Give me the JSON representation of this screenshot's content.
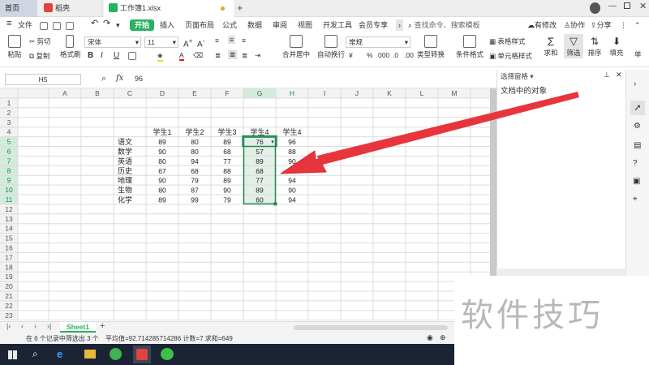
{
  "tabs": [
    {
      "label": "首页"
    },
    {
      "label": "稻壳"
    },
    {
      "label": "工作簿1.xlsx"
    }
  ],
  "menu": {
    "file": "文件",
    "items": [
      "开始",
      "插入",
      "页面布局",
      "公式",
      "数据",
      "审阅",
      "视图",
      "开发工具",
      "会员专享"
    ],
    "search_placeholder": "查找命令、搜索模板",
    "right": [
      "有修改",
      "协作",
      "分享"
    ]
  },
  "ribbon": {
    "paste": "粘贴",
    "cut": "剪切",
    "copy": "复制",
    "format_painter": "格式刷",
    "font": "宋体",
    "font_size": "11",
    "bold": "B",
    "italic": "I",
    "underline": "U",
    "merge": "合并居中",
    "wrap": "自动换行",
    "number_format": "常规",
    "percent": "%",
    "thousand": "000",
    "type_convert": "类型转换",
    "cond_format": "条件格式",
    "table_style": "表格样式",
    "cell_style": "单元格样式",
    "sum": "求和",
    "filter": "筛选",
    "sort": "排序",
    "fill": "填充",
    "single": "单"
  },
  "formula": {
    "cell_ref": "H5",
    "fx": "fx",
    "value": "96"
  },
  "grid": {
    "columns": [
      "A",
      "B",
      "C",
      "D",
      "E",
      "F",
      "G",
      "H",
      "I",
      "J",
      "K",
      "L",
      "M"
    ],
    "rows": [
      "1",
      "2",
      "3",
      "4",
      "5",
      "6",
      "7",
      "8",
      "9",
      "10",
      "11",
      "12",
      "13",
      "14",
      "15",
      "16",
      "17",
      "18",
      "19",
      "20",
      "21",
      "22",
      "23"
    ],
    "headers": [
      "学生1",
      "学生2",
      "学生3",
      "学生4",
      "学生4"
    ],
    "subjects": [
      "语文",
      "数学",
      "英语",
      "历史",
      "地理",
      "生物",
      "化学"
    ],
    "data": [
      [
        "89",
        "80",
        "89",
        "76",
        "96"
      ],
      [
        "90",
        "80",
        "68",
        "57",
        "88"
      ],
      [
        "80",
        "94",
        "77",
        "89",
        "90"
      ],
      [
        "67",
        "68",
        "88",
        "68",
        "97"
      ],
      [
        "90",
        "79",
        "89",
        "77",
        "94"
      ],
      [
        "80",
        "87",
        "90",
        "89",
        "90"
      ],
      [
        "89",
        "99",
        "79",
        "60",
        "94"
      ]
    ]
  },
  "panel": {
    "title": "选择窗格",
    "subtitle": "文档中的对象"
  },
  "sheet": {
    "tab": "Sheet1",
    "add": "+"
  },
  "status": {
    "filter_info": "在 6 个记录中筛选出 3 个",
    "summary": "平均值=92.714285714286 计数=7 求和=649"
  },
  "watermark": "软件技巧",
  "colors": {
    "accent": "#28b262",
    "selection": "#1e8a4f",
    "arrow": "#e8353d"
  }
}
